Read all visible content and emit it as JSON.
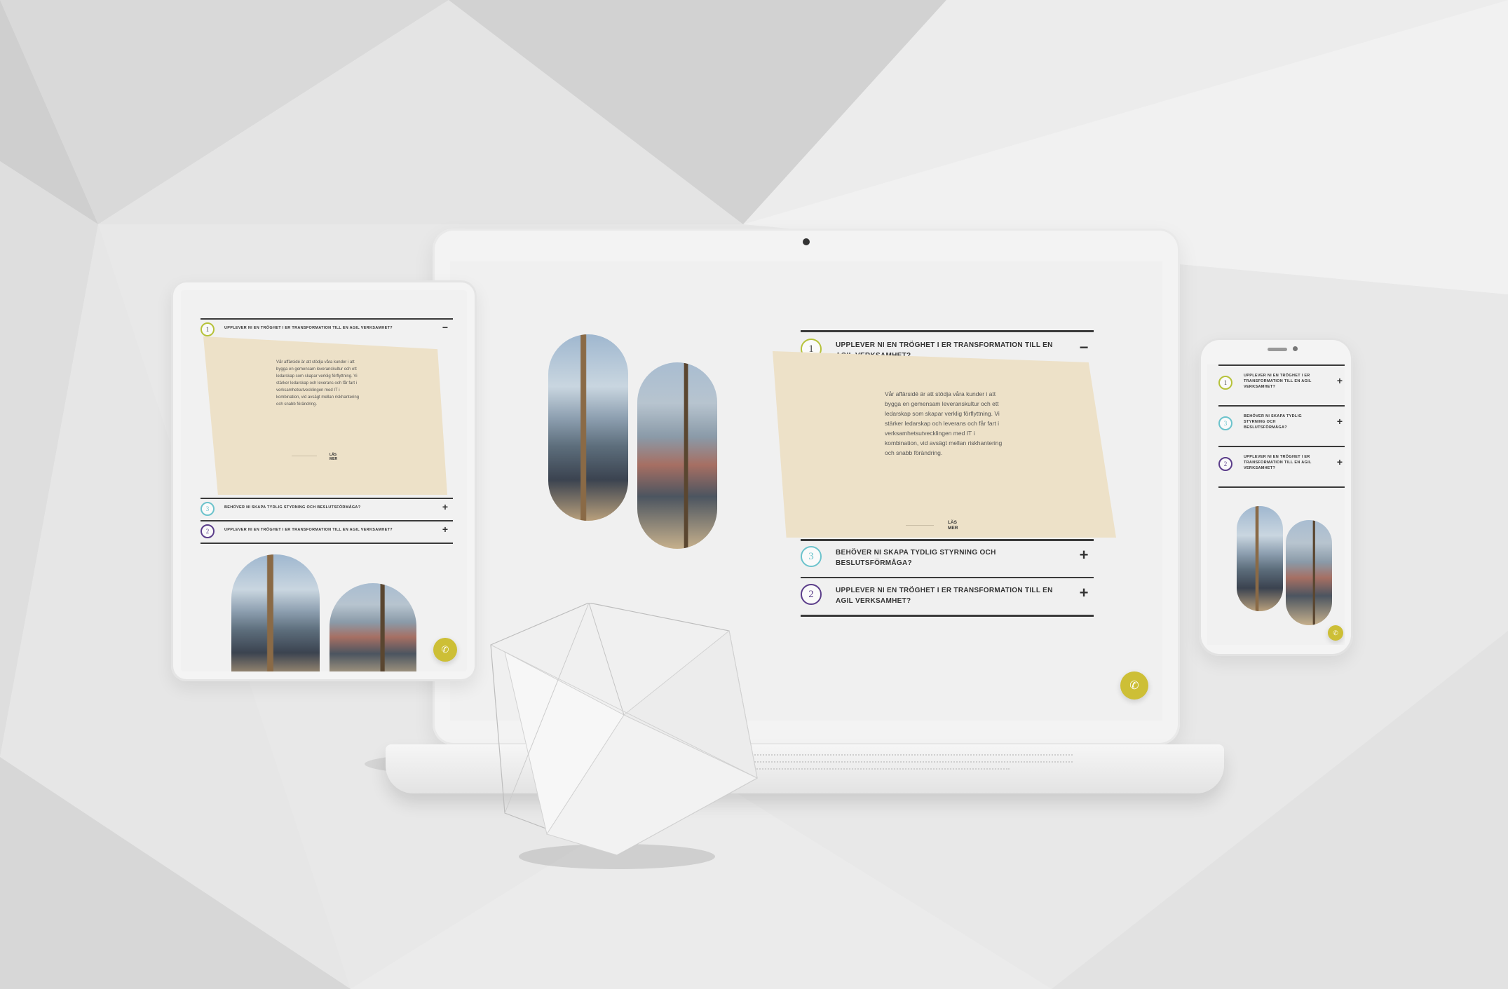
{
  "colors": {
    "panel_bg": "#ede1c8",
    "accent_yellow": "#cdbf36",
    "badge_teal": "#6cc3cc",
    "badge_purple": "#5b3d8a",
    "badge_green": "#b6c23a",
    "divider": "#3a3a3a"
  },
  "laptop": {
    "items": [
      {
        "number": "1",
        "question": "UPPLEVER NI EN TRÖGHET I ER TRANSFORMATION TILL EN AGIL VERKSAMHET?",
        "toggle": "−",
        "badge_color": "#b6c23a"
      },
      {
        "number": "3",
        "question": "BEHÖVER NI SKAPA TYDLIG STYRNING OCH BESLUTSFÖRMÅGA?",
        "toggle": "+",
        "badge_color": "#6cc3cc"
      },
      {
        "number": "2",
        "question": "UPPLEVER NI EN TRÖGHET I ER TRANSFORMATION TILL EN AGIL VERKSAMHET?",
        "toggle": "+",
        "badge_color": "#5b3d8a"
      }
    ],
    "panel_text": "Vår affärsidé är att stödja våra kunder i att bygga en gemensam leveranskultur och ett ledarskap som skapar verklig förflyttning. Vi stärker ledarskap och leverans och får fart i verksamhetsutvecklingen med IT i kombination, vid avsägt mellan riskhantering och snabb förändring.",
    "more_label": "LÄS MER",
    "chat_icon": "chat-icon"
  },
  "tablet": {
    "items": [
      {
        "number": "1",
        "question": "UPPLEVER NI EN TRÖGHET I ER TRANSFORMATION TILL EN AGIL VERKSAMHET?",
        "toggle": "−"
      },
      {
        "number": "3",
        "question": "BEHÖVER NI SKAPA TYDLIG STYRNING OCH BESLUTSFÖRMÅGA?",
        "toggle": "+"
      },
      {
        "number": "2",
        "question": "UPPLEVER NI EN TRÖGHET I ER TRANSFORMATION TILL EN AGIL VERKSAMHET?",
        "toggle": "+"
      }
    ],
    "panel_text": "Vår affärsidé är att stödja våra kunder i att bygga en gemensam leveranskultur och ett ledarskap som skapar verklig förflyttning. Vi stärker ledarskap och leverans och får fart i verksamhetsutvecklingen med IT i kombination, vid avsägt mellan riskhantering och snabb förändring.",
    "more_label": "LÄS MER"
  },
  "phone": {
    "items": [
      {
        "number": "1",
        "question": "UPPLEVER NI EN TRÖGHET I ER TRANSFORMATION TILL EN AGIL VERKSAMHET?",
        "toggle": "+"
      },
      {
        "number": "3",
        "question": "BEHÖVER NI SKAPA TYDLIG STYRNING OCH BESLUTSFÖRMÅGA?",
        "toggle": "+"
      },
      {
        "number": "2",
        "question": "UPPLEVER NI EN TRÖGHET I ER TRANSFORMATION TILL EN AGIL VERKSAMHET?",
        "toggle": "+"
      }
    ]
  }
}
